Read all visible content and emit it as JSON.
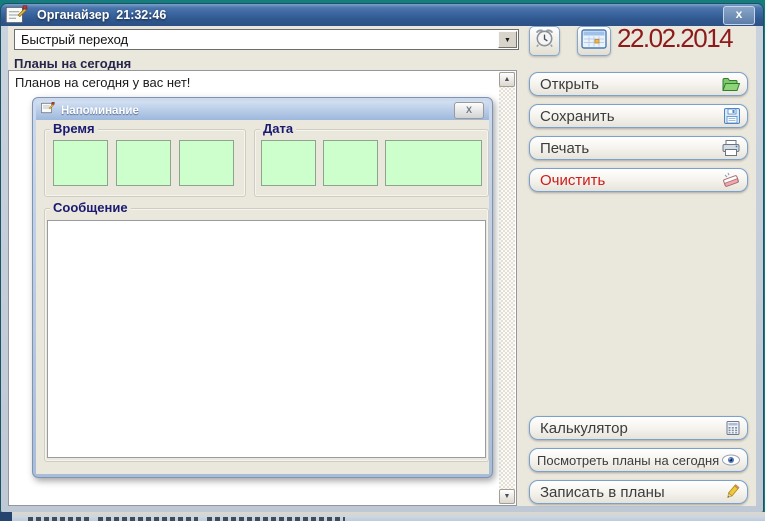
{
  "window": {
    "title": "Органайзер  21:32:46",
    "close_glyph": "x"
  },
  "toolbar": {
    "quick_nav_value": "Быстрый переход",
    "date": "22.02.2014"
  },
  "plans": {
    "section_label": "Планы на сегодня",
    "empty_message": "Планов на сегодня у вас нет!"
  },
  "reminder": {
    "title": "Напоминание",
    "close_glyph": "X",
    "time_label": "Время",
    "date_label": "Дата",
    "message_label": "Сообщение",
    "time_values": [
      "",
      "",
      ""
    ],
    "date_values": [
      "",
      "",
      ""
    ],
    "message_value": ""
  },
  "actions": {
    "open": "Открыть",
    "save": "Сохранить",
    "print": "Печать",
    "clear": "Очистить",
    "calculator": "Калькулятор",
    "view_plans": "Посмотреть планы на сегодня",
    "write_plans": "Записать в планы"
  },
  "glyphs": {
    "scroll_up": "▲",
    "scroll_down": "▼",
    "combo_arrow": "▼"
  },
  "colors": {
    "desktop": "#157d7d",
    "titlebar_blue": "#3a659f",
    "date_red": "#8e1a1a",
    "clear_red": "#cc1c1c",
    "field_green": "#ccffcc",
    "window_face": "#eae7dd"
  }
}
